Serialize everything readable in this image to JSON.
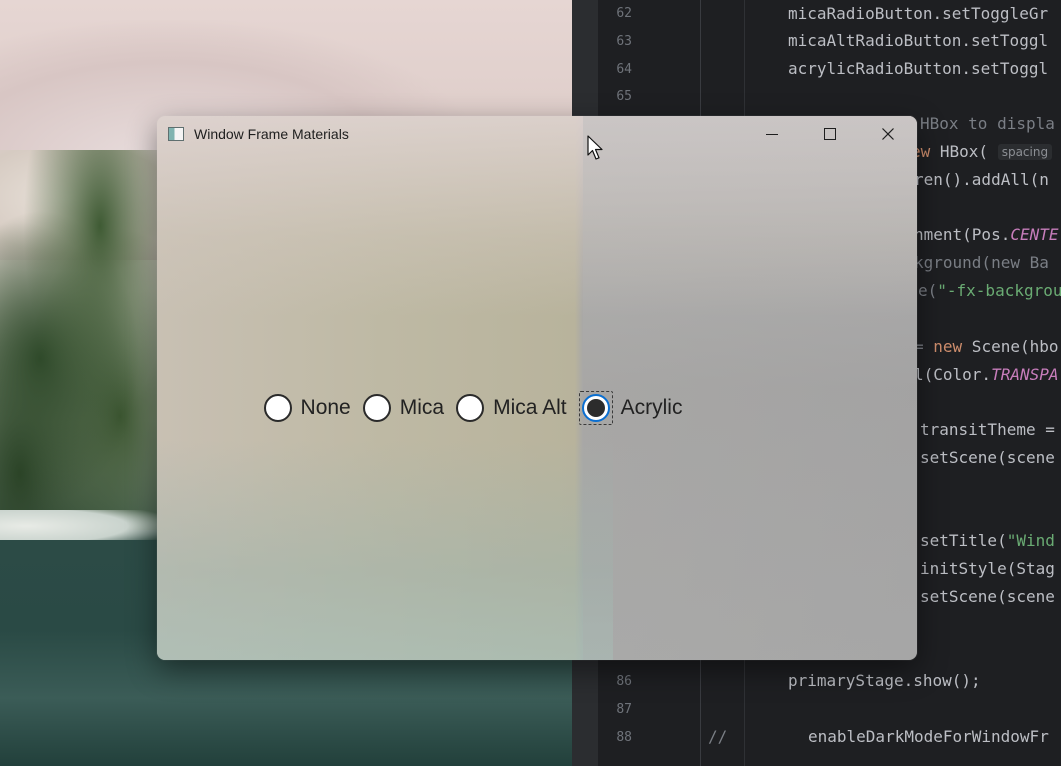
{
  "ide": {
    "lines": [
      {
        "num": "62",
        "code": "micaRadioButton.setToggleGr"
      },
      {
        "num": "63",
        "code": "micaAltRadioButton.setToggl"
      },
      {
        "num": "64",
        "code": "acrylicRadioButton.setToggl"
      },
      {
        "num": "65",
        "code": ""
      },
      {
        "num": "86",
        "code": "primaryStage.show();"
      },
      {
        "num": "87",
        "code": ""
      },
      {
        "num": "88",
        "code": "enableDarkModeForWindowFr"
      }
    ],
    "comment_marker": "//",
    "peek": {
      "l1_comment": "HBox to displa",
      "l2_kw": "ew",
      "l2_text": " HBox( ",
      "l2_hint": "spacing",
      "l3": "ren().addAll(n",
      "l4_a": "nment(Pos.",
      "l4_b": "CENTE",
      "l5": "kground(new Ba",
      "l6_a": "e(",
      "l6_b": "\"-fx-backgrou",
      "l7_a": "= ",
      "l7_b": "new",
      "l7_c": " Scene(hbo",
      "l8_a": "l(Color.",
      "l8_b": "TRANSPA",
      "l9": "transitTheme =",
      "l10": "setScene(scene",
      "l11_a": "setTitle(",
      "l11_b": "\"Wind",
      "l12": "initStyle(Stag",
      "l13": "setScene(scene"
    }
  },
  "window": {
    "title": "Window Frame Materials",
    "controls": [
      "minimize-icon",
      "maximize-icon",
      "close-icon"
    ]
  },
  "radio_options": [
    {
      "label": "None",
      "checked": false
    },
    {
      "label": "Mica",
      "checked": false
    },
    {
      "label": "Mica Alt",
      "checked": false
    },
    {
      "label": "Acrylic",
      "checked": true
    }
  ]
}
